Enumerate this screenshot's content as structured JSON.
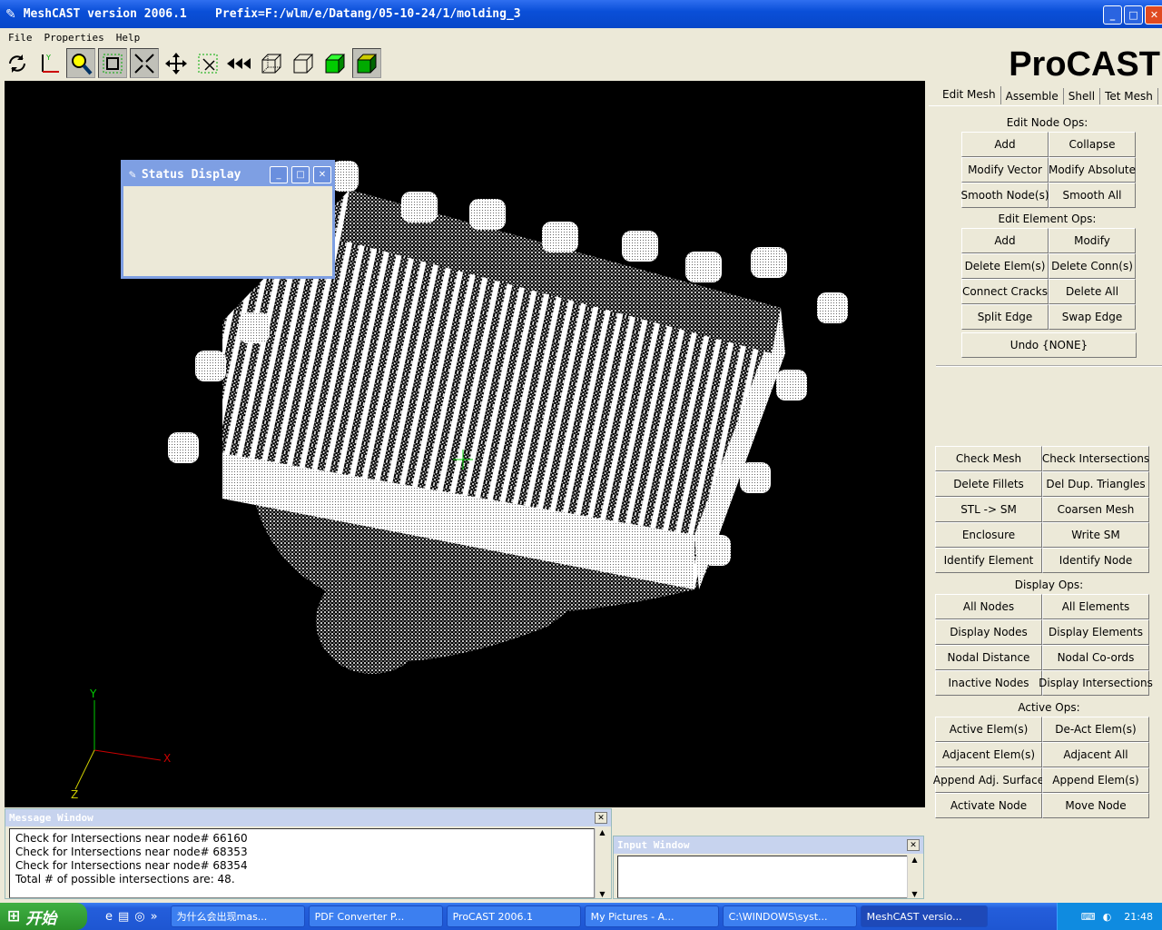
{
  "window": {
    "title": "MeshCAST version 2006.1    Prefix=F:/wlm/e/Datang/05-10-24/1/molding_3"
  },
  "menu": [
    "File",
    "Properties",
    "Help"
  ],
  "logo": "ProCAST",
  "tabs": [
    "Edit Mesh",
    "Assemble",
    "Shell",
    "Tet Mesh"
  ],
  "edit_node": {
    "title": "Edit Node Ops:",
    "buttons": [
      "Add",
      "Collapse",
      "Modify Vector",
      "Modify Absolute",
      "Smooth Node(s)",
      "Smooth All"
    ]
  },
  "edit_elem": {
    "title": "Edit Element Ops:",
    "buttons": [
      "Add",
      "Modify",
      "Delete Elem(s)",
      "Delete Conn(s)",
      "Connect Cracks",
      "Delete All",
      "Split Edge",
      "Swap Edge"
    ]
  },
  "undo": "Undo {NONE}",
  "tools": [
    "Check Mesh",
    "Check Intersections",
    "Delete Fillets",
    "Del Dup. Triangles",
    "STL -> SM",
    "Coarsen Mesh",
    "Enclosure",
    "Write SM",
    "Identify Element",
    "Identify Node"
  ],
  "display": {
    "title": "Display Ops:",
    "buttons": [
      "All Nodes",
      "All Elements",
      "Display Nodes",
      "Display Elements",
      "Nodal Distance",
      "Nodal Co-ords",
      "Inactive Nodes",
      "Display Intersections"
    ]
  },
  "active": {
    "title": "Active Ops:",
    "buttons": [
      "Active Elem(s)",
      "De-Act Elem(s)",
      "Adjacent Elem(s)",
      "Adjacent All",
      "Append Adj. Surface",
      "Append Elem(s)",
      "Activate Node",
      "Move Node"
    ]
  },
  "status_dialog": {
    "title": "Status Display"
  },
  "axes": {
    "x": "X",
    "y": "Y",
    "z": "Z"
  },
  "message_window": {
    "title": "Message Window",
    "lines": [
      "Check for Intersections near node# 66160",
      "Check for Intersections near node# 68353",
      "Check for Intersections near node# 68354",
      "Total # of possible intersections are: 48."
    ]
  },
  "input_window": {
    "title": "Input Window"
  },
  "taskbar": {
    "start": "开始",
    "tasks": [
      "为什么会出现mas...",
      "PDF Converter P...",
      "ProCAST 2006.1",
      "My Pictures - A...",
      "C:\\WINDOWS\\syst...",
      "MeshCAST versio..."
    ],
    "clock": "21:48"
  }
}
